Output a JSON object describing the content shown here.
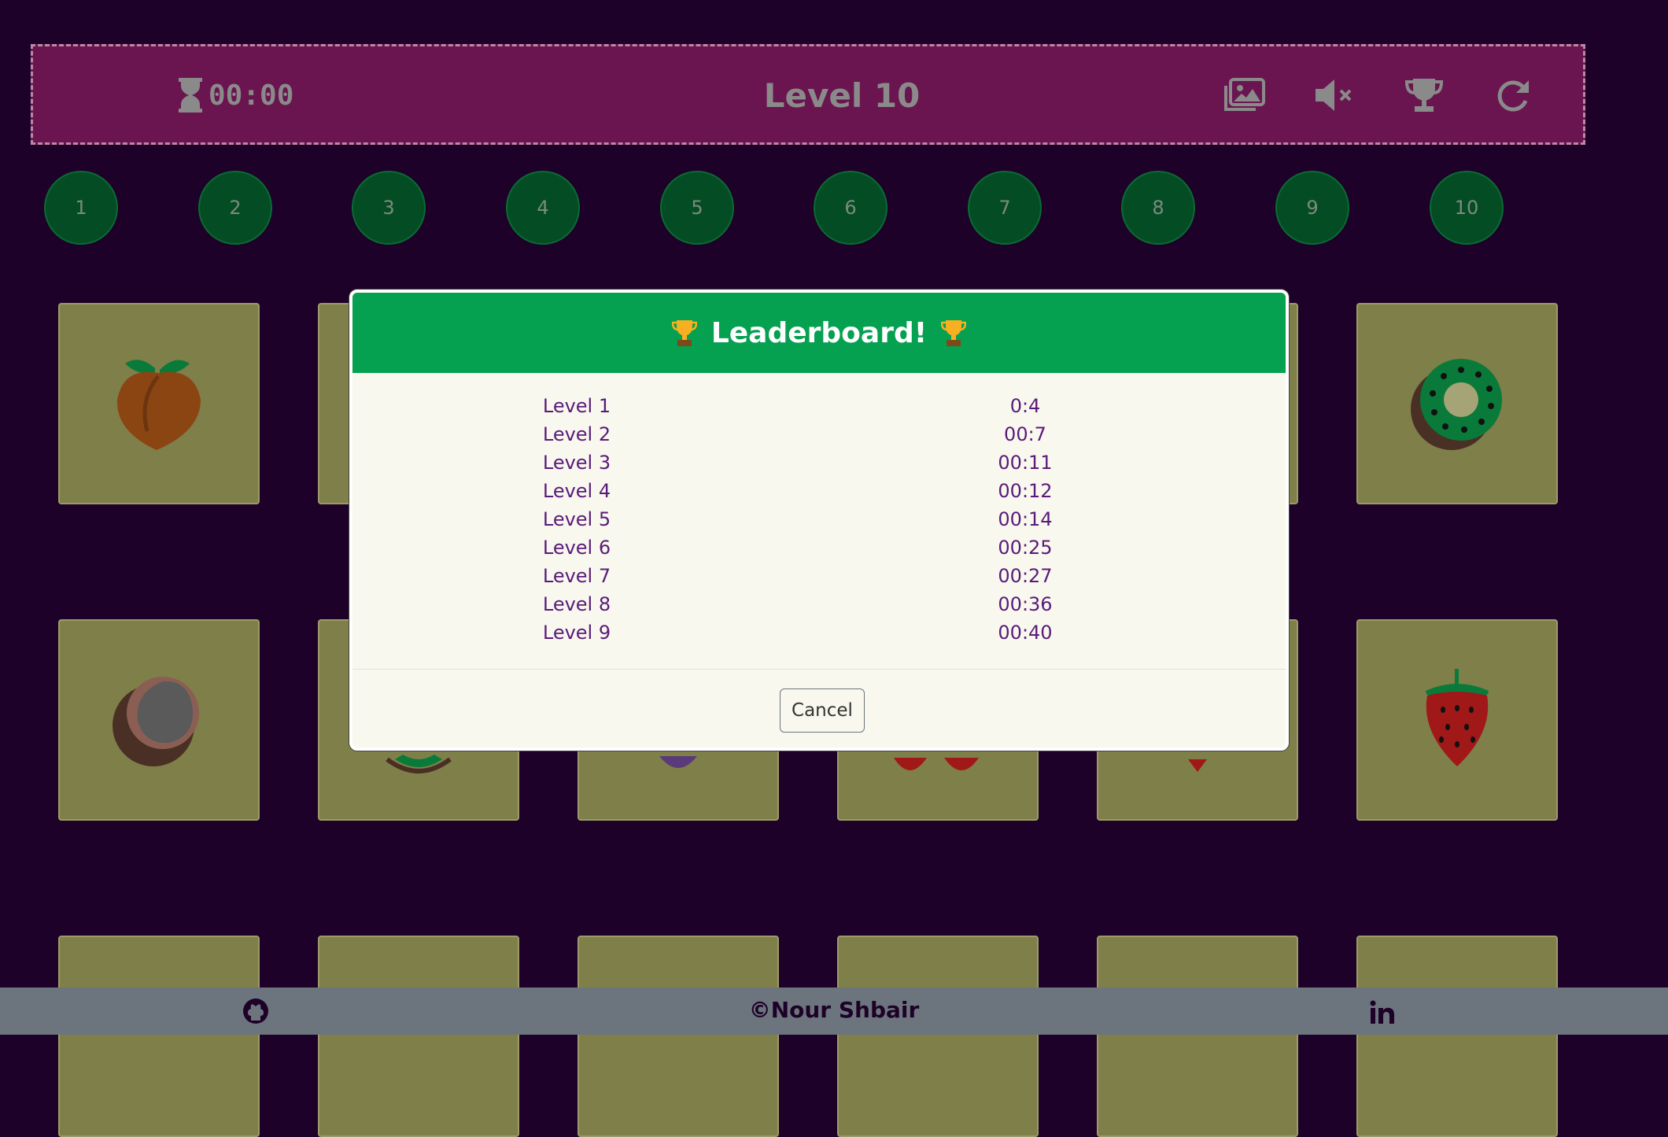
{
  "header": {
    "timer": "00:00",
    "level_title": "Level 10",
    "icons": [
      "image-icon",
      "mute-icon",
      "trophy-icon",
      "restart-icon"
    ]
  },
  "levels": [
    "1",
    "2",
    "3",
    "4",
    "5",
    "6",
    "7",
    "8",
    "9",
    "10"
  ],
  "cards": {
    "row1": [
      "peach",
      "hidden",
      "hidden",
      "hidden",
      "hidden",
      "kiwi"
    ],
    "row2": [
      "coconut",
      "melon",
      "plum",
      "cherries",
      "strawberry-partial",
      "strawberry"
    ]
  },
  "modal": {
    "title": "Leaderboard!",
    "rows": [
      {
        "level": "Level 1",
        "time": "0:4"
      },
      {
        "level": "Level 2",
        "time": "00:7"
      },
      {
        "level": "Level 3",
        "time": "00:11"
      },
      {
        "level": "Level 4",
        "time": "00:12"
      },
      {
        "level": "Level 5",
        "time": "00:14"
      },
      {
        "level": "Level 6",
        "time": "00:25"
      },
      {
        "level": "Level 7",
        "time": "00:27"
      },
      {
        "level": "Level 8",
        "time": "00:36"
      },
      {
        "level": "Level 9",
        "time": "00:40"
      }
    ],
    "cancel_label": "Cancel"
  },
  "footer": {
    "credit": "©Nour Shbair",
    "icons": [
      "github-icon",
      "linkedin-icon"
    ]
  },
  "colors": {
    "background": "#1e0128",
    "header_bar": "#6a1550",
    "level_circle": "#044d24",
    "card": "#7f7f49",
    "modal_header": "#05a050",
    "modal_text": "#5a1a7a",
    "footer": "#6c757d"
  }
}
